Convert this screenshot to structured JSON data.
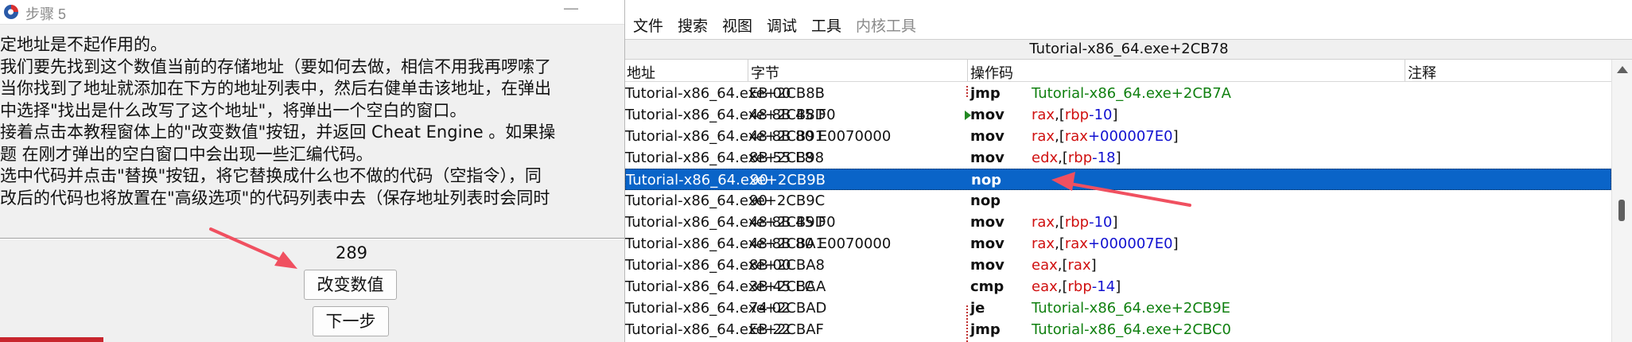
{
  "tutorial": {
    "title": "步骤 5",
    "description_lines": [
      "定地址是不起作用的。",
      "我们要先找到这个数值当前的存储地址（要如何去做，相信不用我再啰嗦了",
      "当你找到了地址就添加在下方的地址列表中，然后右健单击该地址，在弹出",
      "中选择\"找出是什么改写了这个地址\"，将弹出一个空白的窗口。",
      "接着点击本教程窗体上的\"改变数值\"按钮，并返回 Cheat Engine 。如果操",
      "题 在刚才弹出的空白窗口中会出现一些汇编代码。",
      "选中代码并点击\"替换\"按钮，将它替换成什么也不做的代码（空指令），同",
      "改后的代码也将放置在\"高级选项\"的代码列表中去（保存地址列表时会同时"
    ],
    "value": "289",
    "change_button": "改变数值",
    "next_button": "下一步"
  },
  "memory_viewer": {
    "menu": [
      "文件",
      "搜索",
      "视图",
      "调试",
      "工具",
      "内核工具"
    ],
    "current_address": "Tutorial-x86_64.exe+2CB78",
    "columns": [
      "地址",
      "字节",
      "操作码",
      "注释"
    ],
    "rows": [
      {
        "addr": "Tutorial-x86_64.exe+2CB8B",
        "bytes": "EB 00",
        "op": "jmp",
        "args": [
          {
            "t": "Tutorial-x86_64.exe+2CB7A",
            "c": "jmpt"
          }
        ]
      },
      {
        "addr": "Tutorial-x86_64.exe+2CB8D",
        "bytes": "48 8B 45 F0",
        "op": "mov",
        "args": [
          {
            "t": "rax",
            "c": "reg"
          },
          {
            "t": ",[",
            "c": "punct"
          },
          {
            "t": "rbp",
            "c": "reg"
          },
          {
            "t": "-10",
            "c": "num"
          },
          {
            "t": "]",
            "c": "punct"
          }
        ]
      },
      {
        "addr": "Tutorial-x86_64.exe+2CB91",
        "bytes": "48 8B 80 E0070000",
        "op": "mov",
        "args": [
          {
            "t": "rax",
            "c": "reg"
          },
          {
            "t": ",[",
            "c": "punct"
          },
          {
            "t": "rax",
            "c": "reg"
          },
          {
            "t": "+000007E0",
            "c": "num"
          },
          {
            "t": "]",
            "c": "punct"
          }
        ]
      },
      {
        "addr": "Tutorial-x86_64.exe+2CB98",
        "bytes": "8B 55 E8",
        "op": "mov",
        "args": [
          {
            "t": "edx",
            "c": "reg"
          },
          {
            "t": ",[",
            "c": "punct"
          },
          {
            "t": "rbp",
            "c": "reg"
          },
          {
            "t": "-18",
            "c": "num"
          },
          {
            "t": "]",
            "c": "punct"
          }
        ]
      },
      {
        "addr": "Tutorial-x86_64.exe+2CB9B",
        "bytes": "90",
        "op": "nop",
        "args": [],
        "selected": true
      },
      {
        "addr": "Tutorial-x86_64.exe+2CB9C",
        "bytes": "90",
        "op": "nop",
        "args": []
      },
      {
        "addr": "Tutorial-x86_64.exe+2CB9D",
        "bytes": "48 8B 45 F0",
        "op": "mov",
        "args": [
          {
            "t": "rax",
            "c": "reg"
          },
          {
            "t": ",[",
            "c": "punct"
          },
          {
            "t": "rbp",
            "c": "reg"
          },
          {
            "t": "-10",
            "c": "num"
          },
          {
            "t": "]",
            "c": "punct"
          }
        ]
      },
      {
        "addr": "Tutorial-x86_64.exe+2CBA1",
        "bytes": "48 8B 80 E0070000",
        "op": "mov",
        "args": [
          {
            "t": "rax",
            "c": "reg"
          },
          {
            "t": ",[",
            "c": "punct"
          },
          {
            "t": "rax",
            "c": "reg"
          },
          {
            "t": "+000007E0",
            "c": "num"
          },
          {
            "t": "]",
            "c": "punct"
          }
        ]
      },
      {
        "addr": "Tutorial-x86_64.exe+2CBA8",
        "bytes": "8B 00",
        "op": "mov",
        "args": [
          {
            "t": "eax",
            "c": "reg"
          },
          {
            "t": ",[",
            "c": "punct"
          },
          {
            "t": "rax",
            "c": "reg"
          },
          {
            "t": "]",
            "c": "punct"
          }
        ]
      },
      {
        "addr": "Tutorial-x86_64.exe+2CBAA",
        "bytes": "3B 45 EC",
        "op": "cmp",
        "args": [
          {
            "t": "eax",
            "c": "reg"
          },
          {
            "t": ",[",
            "c": "punct"
          },
          {
            "t": "rbp",
            "c": "reg"
          },
          {
            "t": "-14",
            "c": "num"
          },
          {
            "t": "]",
            "c": "punct"
          }
        ]
      },
      {
        "addr": "Tutorial-x86_64.exe+2CBAD",
        "bytes": "74 02",
        "op": "je",
        "args": [
          {
            "t": "Tutorial-x86_64.exe+2CB9E",
            "c": "jmpt"
          }
        ]
      },
      {
        "addr": "Tutorial-x86_64.exe+2CBAF",
        "bytes": "EB 22",
        "op": "jmp",
        "args": [
          {
            "t": "Tutorial-x86_64.exe+2CBC0",
            "c": "jmpt"
          }
        ]
      }
    ]
  },
  "colors": {
    "selection": "#0a64c8",
    "register": "#d01010",
    "number": "#1010d0",
    "jump_target": "#108010",
    "annotation_arrow": "#f05060"
  }
}
